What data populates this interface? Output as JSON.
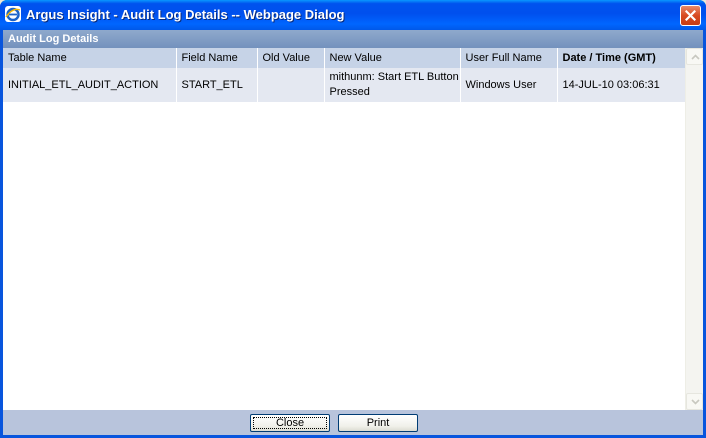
{
  "window": {
    "title": "Argus Insight - Audit Log Details -- Webpage Dialog",
    "close_icon": "close-icon",
    "app_icon": "ie-icon"
  },
  "panel": {
    "header": "Audit Log Details"
  },
  "grid": {
    "columns": [
      "Table Name",
      "Field Name",
      "Old Value",
      "New Value",
      "User Full Name",
      "Date / Time (GMT)"
    ],
    "rows": [
      {
        "table_name": "INITIAL_ETL_AUDIT_ACTION",
        "field_name": "START_ETL",
        "old_value": "",
        "new_value": "mithunm: Start ETL Button Pressed",
        "user_full_name": "Windows User",
        "date_time": "14-JUL-10 03:06:31"
      }
    ]
  },
  "buttons": {
    "close": "Close",
    "print": "Print"
  },
  "colors": {
    "title_bar": "#0055ea",
    "panel_header": "#7f9bc4",
    "grid_header": "#c6d3e7",
    "grid_row": "#e4e8f1",
    "footer": "#b8c4dc"
  }
}
